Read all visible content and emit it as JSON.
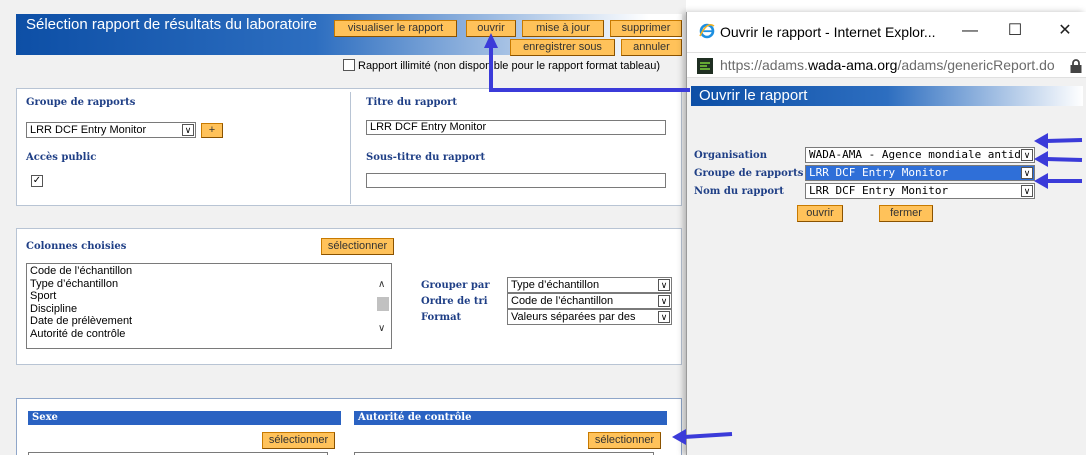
{
  "app": {
    "title": "Sélection rapport de résultats du laboratoire",
    "buttons": {
      "view": "visualiser le rapport",
      "open": "ouvrir",
      "update": "mise à jour",
      "delete": "supprimer",
      "save_as": "enregistrer sous",
      "cancel": "annuler"
    },
    "unlimited_label": "Rapport illimité (non disponible pour le rapport format tableau)",
    "report_group": {
      "label": "Groupe de rapports",
      "value": "LRR DCF Entry Monitor",
      "add_label": "+"
    },
    "public_access": {
      "label": "Accès public",
      "checked_mark": "✓"
    },
    "report_title": {
      "label": "Titre du rapport",
      "value": "LRR DCF Entry Monitor"
    },
    "report_subtitle": {
      "label": "Sous-titre du rapport",
      "value": ""
    },
    "columns": {
      "label": "Colonnes choisies",
      "select_label": "sélectionner",
      "items": [
        "Code de l’échantillon",
        "Type d’échantillon",
        "Sport",
        "Discipline",
        "Date de prélèvement",
        "Autorité de contrôle"
      ]
    },
    "group_by": {
      "label": "Grouper par",
      "value": "Type d’échantillon"
    },
    "sort_order": {
      "label": "Ordre de tri",
      "value": "Code de l’échantillon"
    },
    "format": {
      "label": "Format",
      "value": "Valeurs séparées par des"
    },
    "sex": {
      "label": "Sexe",
      "select_label": "sélectionner"
    },
    "testing_authority": {
      "label": "Autorité de contrôle",
      "select_label": "sélectionner"
    }
  },
  "popup": {
    "window_title": "Ouvrir le rapport - Internet Explor...",
    "url_gray_prefix": "https://adams.",
    "url_domain": "wada-ama.org",
    "url_gray_suffix": "/adams/genericReport.do",
    "heading": "Ouvrir le rapport",
    "organisation": {
      "label": "Organisation",
      "value": "WADA-AMA - Agence mondiale antido"
    },
    "report_group": {
      "label": "Groupe de rapports",
      "value": "LRR DCF Entry Monitor"
    },
    "report_name": {
      "label": "Nom du rapport",
      "value": "LRR DCF Entry Monitor"
    },
    "open_label": "ouvrir",
    "close_label": "fermer"
  },
  "colors": {
    "header_blue": "#0d4fa6",
    "button_orange": "#ffc25a",
    "label_blue": "#1f3f86",
    "annotation_arrow": "#3b3bd9"
  }
}
